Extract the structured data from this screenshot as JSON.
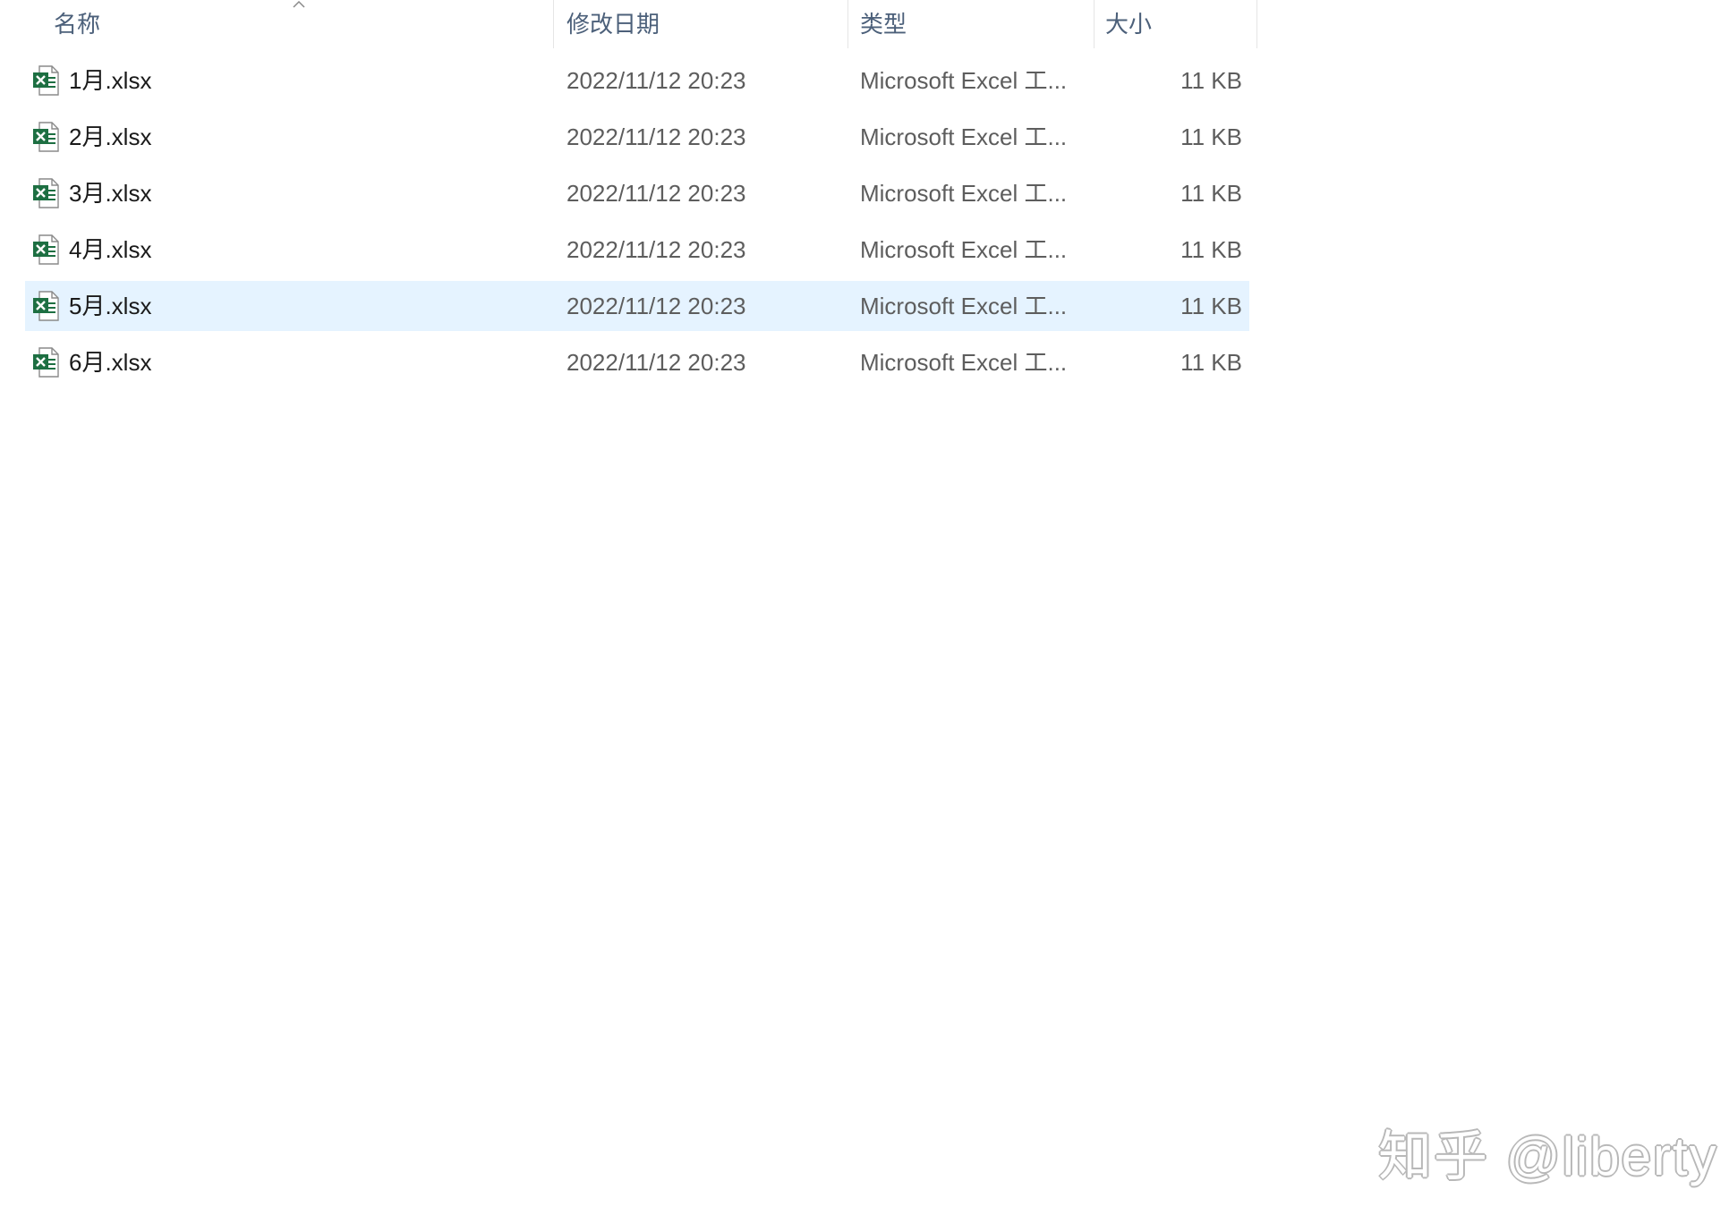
{
  "columns": {
    "name": "名称",
    "modified": "修改日期",
    "type": "类型",
    "size": "大小"
  },
  "sort": {
    "column": "name",
    "direction": "ascending"
  },
  "files": [
    {
      "name": "1月.xlsx",
      "modified": "2022/11/12 20:23",
      "type": "Microsoft Excel 工...",
      "size": "11 KB",
      "selected": false
    },
    {
      "name": "2月.xlsx",
      "modified": "2022/11/12 20:23",
      "type": "Microsoft Excel 工...",
      "size": "11 KB",
      "selected": false
    },
    {
      "name": "3月.xlsx",
      "modified": "2022/11/12 20:23",
      "type": "Microsoft Excel 工...",
      "size": "11 KB",
      "selected": false
    },
    {
      "name": "4月.xlsx",
      "modified": "2022/11/12 20:23",
      "type": "Microsoft Excel 工...",
      "size": "11 KB",
      "selected": false
    },
    {
      "name": "5月.xlsx",
      "modified": "2022/11/12 20:23",
      "type": "Microsoft Excel 工...",
      "size": "11 KB",
      "selected": true
    },
    {
      "name": "6月.xlsx",
      "modified": "2022/11/12 20:23",
      "type": "Microsoft Excel 工...",
      "size": "11 KB",
      "selected": false
    }
  ],
  "file_icon": "excel-file-icon",
  "colors": {
    "selection": "#e5f3ff",
    "header_text": "#4c607a",
    "excel_green": "#1d6f42"
  },
  "watermark": "知乎 @liberty"
}
